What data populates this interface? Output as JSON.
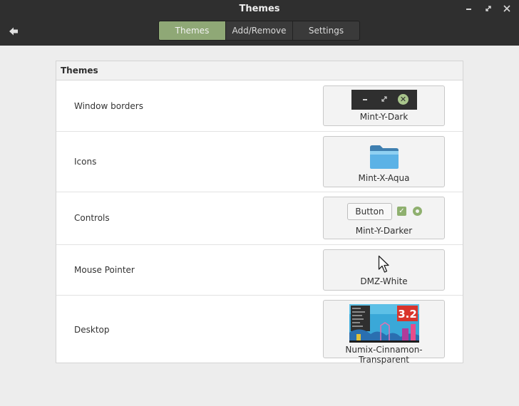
{
  "window": {
    "title": "Themes"
  },
  "controls": {
    "minimize_icon": "minimize-icon",
    "maximize_icon": "maximize-icon",
    "close_icon": "close-icon"
  },
  "nav": {
    "back_icon": "back-arrow-icon"
  },
  "tabs": [
    {
      "label": "Themes",
      "active": true
    },
    {
      "label": "Add/Remove",
      "active": false
    },
    {
      "label": "Settings",
      "active": false
    }
  ],
  "section": {
    "title": "Themes"
  },
  "rows": [
    {
      "label": "Window borders",
      "theme": "Mint-Y-Dark"
    },
    {
      "label": "Icons",
      "theme": "Mint-X-Aqua"
    },
    {
      "label": "Controls",
      "theme": "Mint-Y-Darker",
      "preview_button": "Button"
    },
    {
      "label": "Mouse Pointer",
      "theme": "DMZ-White"
    },
    {
      "label": "Desktop",
      "theme": "Numix-Cinnamon-Transparent",
      "preview_badge": "3.2"
    }
  ],
  "colors": {
    "accent": "#8fa876",
    "header": "#2f2f2f",
    "folder": "#5cb2e6"
  }
}
